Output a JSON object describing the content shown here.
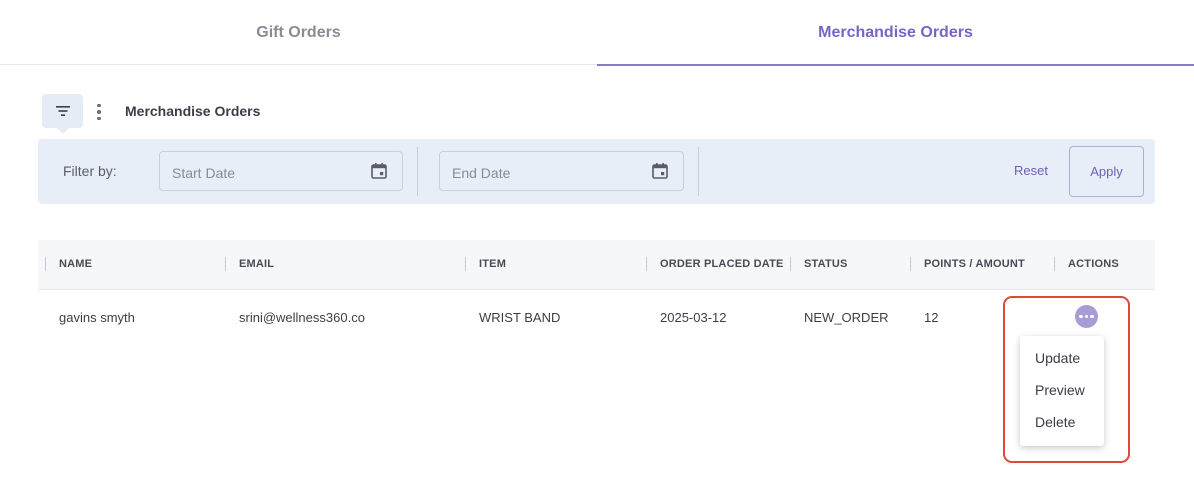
{
  "tabs": [
    {
      "label": "Gift Orders",
      "active": false
    },
    {
      "label": "Merchandise Orders",
      "active": true
    }
  ],
  "toolbar": {
    "filter_icon": "filter-icon",
    "more_icon": "kebab-icon",
    "title": "Merchandise Orders"
  },
  "filter_bar": {
    "label": "Filter by:",
    "start_date_placeholder": "Start Date",
    "end_date_placeholder": "End Date",
    "calendar_icon": "calendar-icon",
    "reset_label": "Reset",
    "apply_label": "Apply"
  },
  "table": {
    "columns": [
      "NAME",
      "EMAIL",
      "ITEM",
      "ORDER PLACED DATE",
      "STATUS",
      "POINTS / AMOUNT",
      "ACTIONS"
    ],
    "rows": [
      {
        "name": "gavins smyth",
        "email": "srini@wellness360.co",
        "item": "WRIST BAND",
        "date": "2025-03-12",
        "status": "NEW_ORDER",
        "points": "12"
      }
    ]
  },
  "actions_menu": {
    "icon": "more-horizontal-icon",
    "items": [
      "Update",
      "Preview",
      "Delete"
    ]
  },
  "colors": {
    "accent": "#7a64c4",
    "filter_bar_bg": "#e8eef7",
    "highlight": "#dc4a3a"
  }
}
